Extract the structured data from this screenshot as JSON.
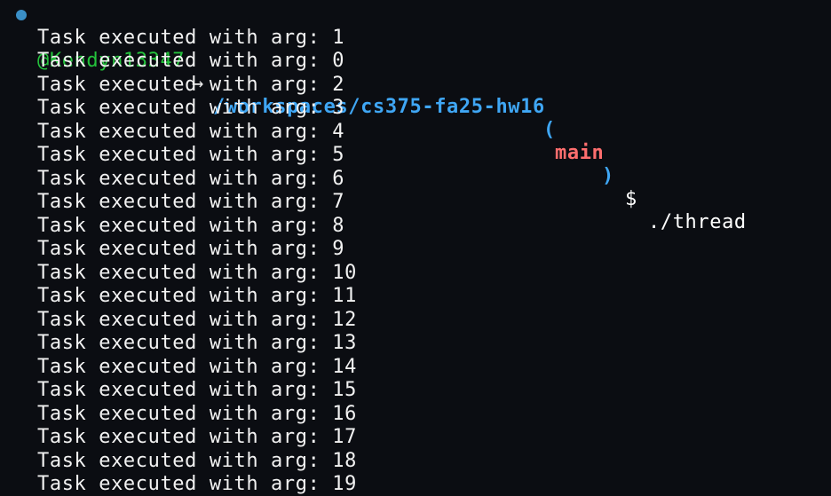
{
  "prompt": {
    "user": "@Kendyn13347",
    "arrow": "→",
    "path": "/workspaces/cs375-fa25-hw16",
    "paren_open": "(",
    "branch": "main",
    "paren_close": ")",
    "dollar": "$",
    "command": "./thread"
  },
  "output": [
    "Task executed with arg: 1",
    "Task executed with arg: 0",
    "Task executed with arg: 2",
    "Task executed with arg: 3",
    "Task executed with arg: 4",
    "Task executed with arg: 5",
    "Task executed with arg: 6",
    "Task executed with arg: 7",
    "Task executed with arg: 8",
    "Task executed with arg: 9",
    "Task executed with arg: 10",
    "Task executed with arg: 11",
    "Task executed with arg: 12",
    "Task executed with arg: 13",
    "Task executed with arg: 14",
    "Task executed with arg: 15",
    "Task executed with arg: 16",
    "Task executed with arg: 17",
    "Task executed with arg: 18",
    "Task executed with arg: 19"
  ],
  "colors": {
    "background": "#0b0d12",
    "user": "#24c23c",
    "path": "#3fa6f4",
    "branch": "#ff6e6e",
    "status_dot": "#3a8fc7",
    "text": "#f2f2f2"
  },
  "icons": {
    "status_dot": "status-dot-icon"
  }
}
